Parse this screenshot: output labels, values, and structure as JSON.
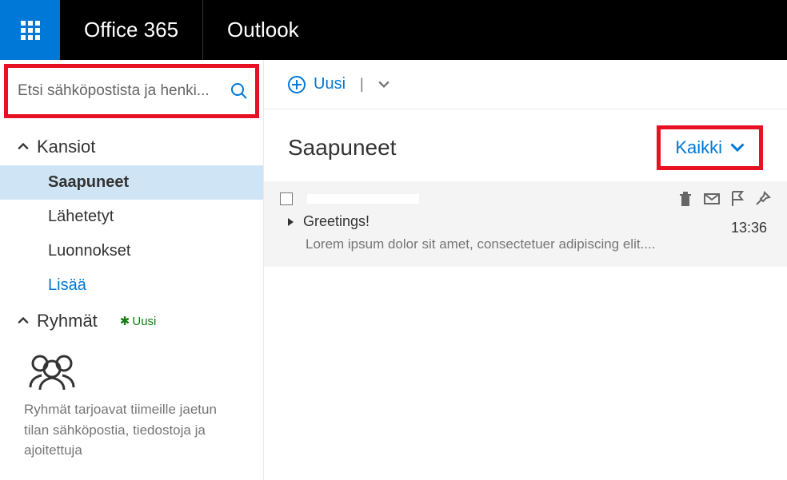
{
  "topbar": {
    "suite": "Office 365",
    "app": "Outlook"
  },
  "search": {
    "placeholder": "Etsi sähköpostista ja henki..."
  },
  "sidebar": {
    "folders_label": "Kansiot",
    "items": [
      {
        "label": "Saapuneet",
        "selected": true
      },
      {
        "label": "Lähetetyt"
      },
      {
        "label": "Luonnokset"
      },
      {
        "label": "Lisää",
        "link": true
      }
    ],
    "groups_label": "Ryhmät",
    "groups_new": "Uusi",
    "groups_promo": "Ryhmät tarjoavat tiimeille jaetun tilan sähköpostia, tiedostoja ja ajoitettuja"
  },
  "toolbar": {
    "new_label": "Uusi"
  },
  "list": {
    "title": "Saapuneet",
    "filter_label": "Kaikki"
  },
  "message": {
    "subject": "Greetings!",
    "time": "13:36",
    "preview": "Lorem ipsum dolor sit amet, consectetuer adipiscing elit...."
  }
}
